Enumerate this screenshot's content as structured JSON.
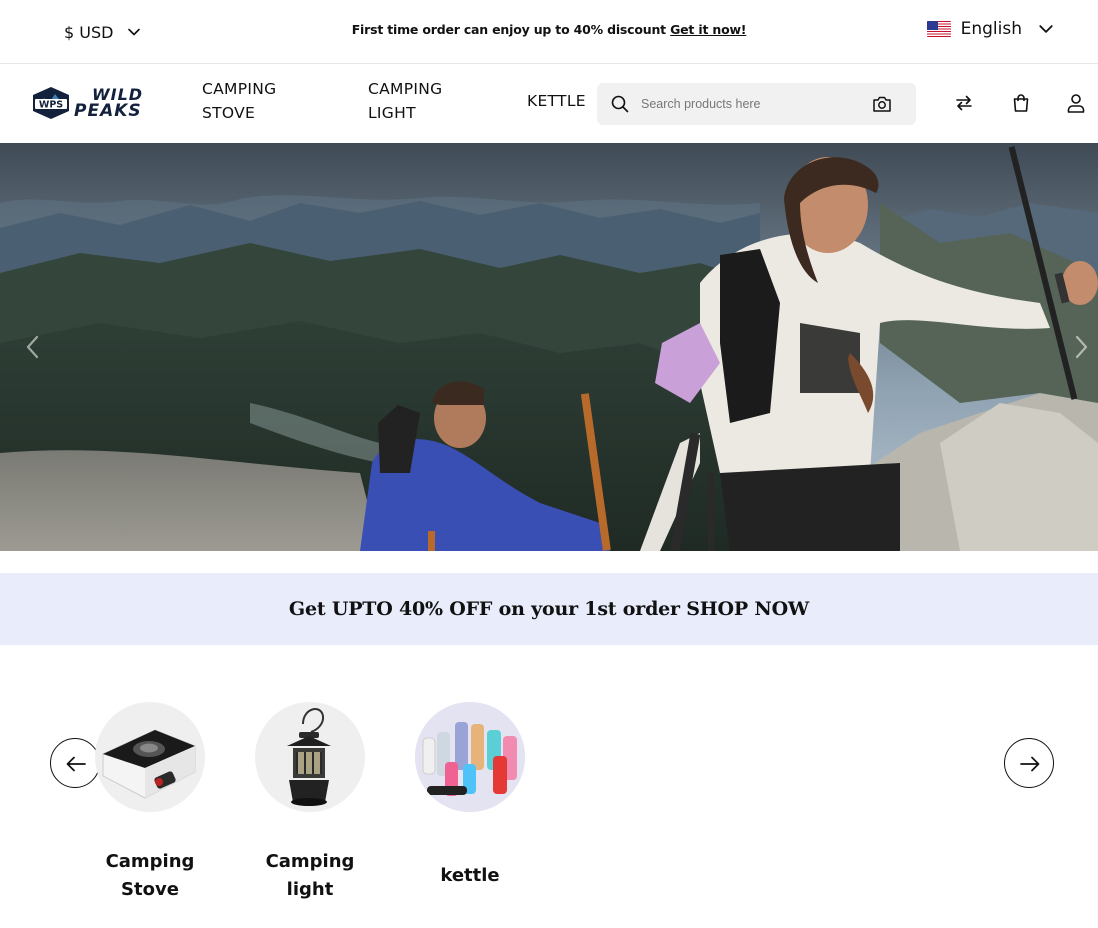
{
  "topbar": {
    "currency": "$ USD",
    "promo_text": "First time order can enjoy up to 40% discount",
    "promo_link": "Get it now!",
    "language": "English"
  },
  "header": {
    "logo_badge": "WPS",
    "logo_line1": "WILD",
    "logo_line2": "PEAKS",
    "nav": [
      {
        "line1": "CAMPING",
        "line2": "STOVE"
      },
      {
        "line1": "CAMPING",
        "line2": "LIGHT"
      },
      {
        "line1": "KETTLE",
        "line2": ""
      }
    ],
    "search_placeholder": "Search products here",
    "icons": [
      "compare-icon",
      "shopping-bag-icon",
      "user-icon"
    ]
  },
  "banner": {
    "text": "Get UPTO 40% OFF on your 1st order SHOP NOW"
  },
  "categories": [
    {
      "line1": "Camping",
      "line2": "Stove",
      "icon": "camping-stove-image"
    },
    {
      "line1": "Camping",
      "line2": "light",
      "icon": "camping-lantern-image"
    },
    {
      "line1": "kettle",
      "line2": "",
      "icon": "bottles-image"
    }
  ],
  "colors": {
    "banner_bg": "#e8ecfb",
    "search_bg": "#f1f1f1",
    "logo_navy": "#14213d"
  }
}
